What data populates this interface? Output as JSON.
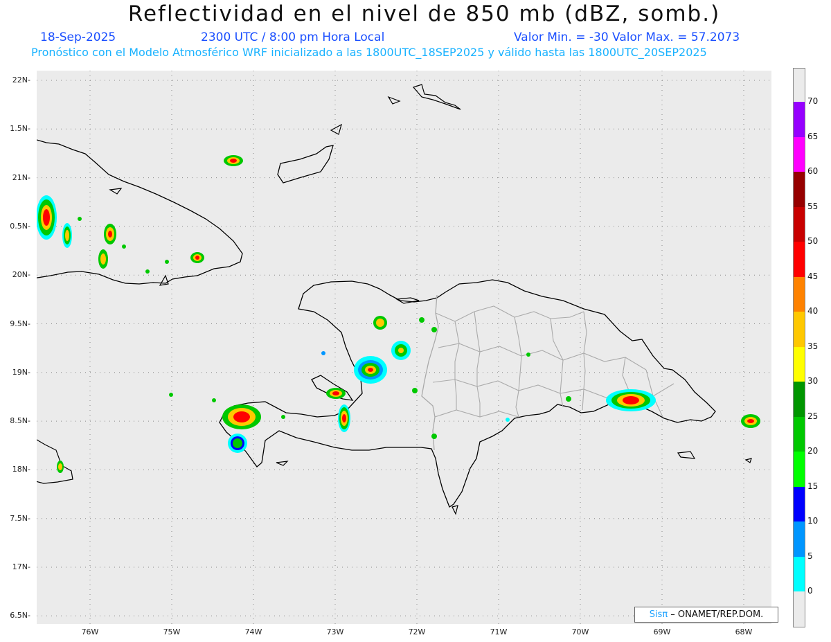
{
  "header": {
    "title": "Reflectividad en el nivel de 850 mb (dBZ, somb.)",
    "date": "18-Sep-2025",
    "time": "2300 UTC / 8:00 pm Hora Local",
    "minmax": "Valor Min. = -30  Valor Max. = 57.2073",
    "forecast": "Pronóstico con el Modelo Atmosférico WRF inicializado a las 1800UTC_18SEP2025 y válido hasta las  1800UTC_20SEP2025"
  },
  "axes": {
    "lat_labels": [
      "22N",
      "1.5N",
      "21N",
      "0.5N",
      "20N",
      "9.5N",
      "19N",
      "8.5N",
      "18N",
      "7.5N",
      "17N",
      "6.5N"
    ],
    "lon_labels": [
      "76W",
      "75W",
      "74W",
      "73W",
      "72W",
      "71W",
      "70W",
      "69W",
      "68W"
    ]
  },
  "colorbar": {
    "labels": [
      "0",
      "5",
      "10",
      "15",
      "20",
      "25",
      "30",
      "35",
      "40",
      "45",
      "50",
      "55",
      "60",
      "65",
      "70"
    ],
    "colors": [
      "#00ffff",
      "#0096ff",
      "#0000ff",
      "#00ff00",
      "#00c800",
      "#009600",
      "#ffff00",
      "#ffc800",
      "#ff8200",
      "#ff0000",
      "#c80000",
      "#960000",
      "#ff00ff",
      "#9600ff"
    ]
  },
  "credit": {
    "sis": "Sisπ",
    "rest": " – ONAMET/REP.DOM."
  },
  "colors": {
    "ocean": "#ebebeb",
    "coast": "#000000",
    "province_border": "#aaaaaa",
    "grid": "#888888"
  }
}
